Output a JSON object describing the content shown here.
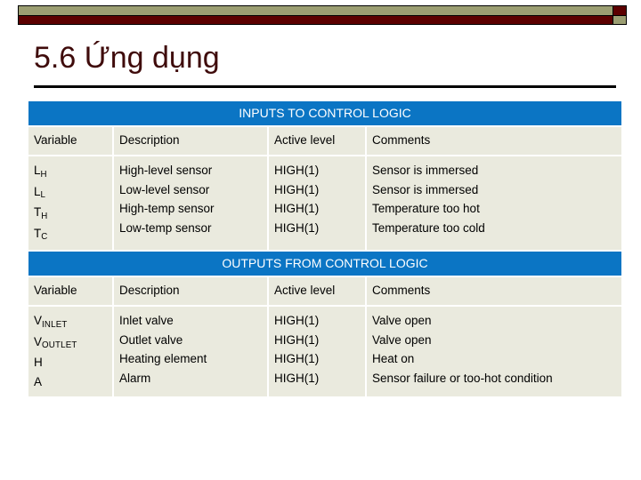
{
  "banner": {
    "olive_color": "#9b9e72",
    "dark_red_color": "#5c0000"
  },
  "slide": {
    "title": "5.6 Ứng dụng",
    "title_color": "#3f0b0b"
  },
  "table": {
    "band_color": "#0b75c4",
    "cell_color": "#eaeade",
    "column_headers": {
      "variable": "Variable",
      "description": "Description",
      "active_level": "Active level",
      "comments": "Comments"
    },
    "sections": [
      {
        "band_label": "INPUTS TO CONTROL LOGIC",
        "rows": [
          {
            "variable_base": "L",
            "variable_sub": "H",
            "description": "High-level sensor",
            "active_level": "HIGH(1)",
            "comments": "Sensor is immersed"
          },
          {
            "variable_base": "L",
            "variable_sub": "L",
            "description": "Low-level sensor",
            "active_level": "HIGH(1)",
            "comments": "Sensor is immersed"
          },
          {
            "variable_base": "T",
            "variable_sub": "H",
            "description": "High-temp sensor",
            "active_level": "HIGH(1)",
            "comments": "Temperature too hot"
          },
          {
            "variable_base": "T",
            "variable_sub": "C",
            "description": "Low-temp sensor",
            "active_level": "HIGH(1)",
            "comments": "Temperature too cold"
          }
        ]
      },
      {
        "band_label": "OUTPUTS FROM CONTROL LOGIC",
        "rows": [
          {
            "variable_base": "V",
            "variable_sub": "INLET",
            "description": "Inlet valve",
            "active_level": "HIGH(1)",
            "comments": "Valve open"
          },
          {
            "variable_base": "V",
            "variable_sub": "OUTLET",
            "description": "Outlet valve",
            "active_level": "HIGH(1)",
            "comments": "Valve open"
          },
          {
            "variable_base": "H",
            "variable_sub": "",
            "description": "Heating element",
            "active_level": "HIGH(1)",
            "comments": "Heat on"
          },
          {
            "variable_base": "A",
            "variable_sub": "",
            "description": "Alarm",
            "active_level": "HIGH(1)",
            "comments": "Sensor failure or too-hot condition"
          }
        ]
      }
    ]
  }
}
